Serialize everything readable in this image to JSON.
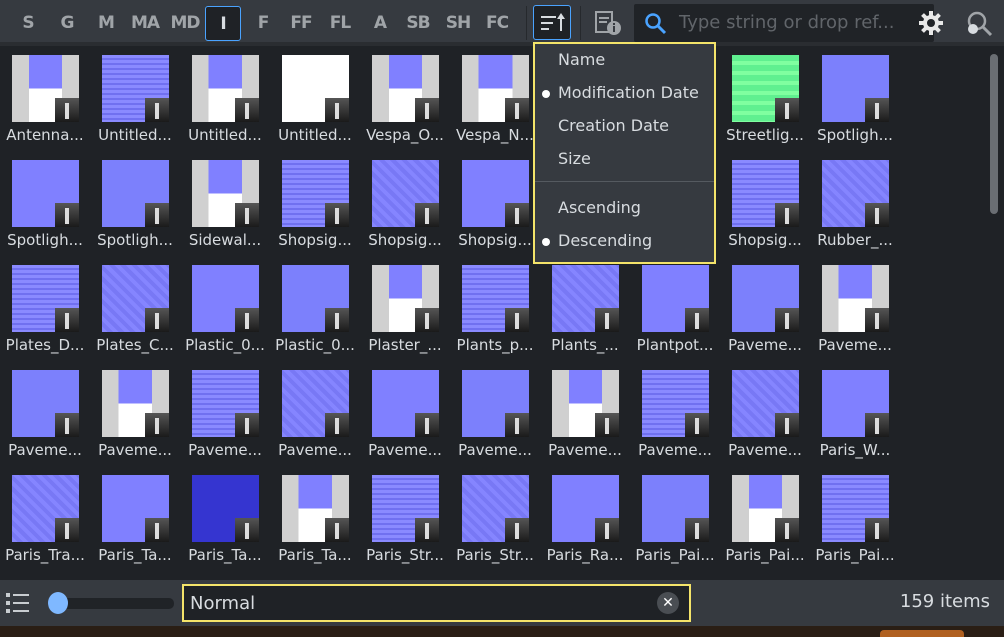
{
  "toolbar": {
    "filters": [
      {
        "label": "S"
      },
      {
        "label": "G"
      },
      {
        "label": "M"
      },
      {
        "label": "MA"
      },
      {
        "label": "MD"
      },
      {
        "label": "I",
        "active": true
      },
      {
        "label": "F"
      },
      {
        "label": "FF"
      },
      {
        "label": "FL"
      },
      {
        "label": "A"
      },
      {
        "label": "SB"
      },
      {
        "label": "SH"
      },
      {
        "label": "FC"
      }
    ],
    "sort_icon": "sort-ascending-icon",
    "info_icon": "document-info-icon",
    "search": {
      "placeholder": "Type string or drop ref...",
      "icon": "search-icon"
    },
    "settings_icon": "gear-icon",
    "find_icon": "find-references-icon"
  },
  "sort_menu": {
    "fields": [
      {
        "label": "Name",
        "selected": false
      },
      {
        "label": "Modification Date",
        "selected": true
      },
      {
        "label": "Creation Date",
        "selected": false
      },
      {
        "label": "Size",
        "selected": false
      }
    ],
    "order": [
      {
        "label": "Ascending",
        "selected": false
      },
      {
        "label": "Descending",
        "selected": true
      }
    ]
  },
  "assets": [
    [
      "Antenna...",
      "Untitled...",
      "Untitled...",
      "Untitled...",
      "Vespa_O...",
      "Vespa_N...",
      "",
      "",
      "Streetlig...",
      "Spotligh..."
    ],
    [
      "Spotligh...",
      "Spotligh...",
      "Sidewal...",
      "Shopsig...",
      "Shopsig...",
      "Shopsig...",
      "",
      "",
      "Shopsig...",
      "Rubber_..."
    ],
    [
      "Plates_D...",
      "Plates_C...",
      "Plastic_0...",
      "Plastic_0...",
      "Plaster_...",
      "Plants_p...",
      "Plants_...",
      "Plantpot...",
      "Paveme...",
      "Paveme..."
    ],
    [
      "Paveme...",
      "Paveme...",
      "Paveme...",
      "Paveme...",
      "Paveme...",
      "Paveme...",
      "Paveme...",
      "Paveme...",
      "Paveme...",
      "Paris_W..."
    ],
    [
      "Paris_Tra...",
      "Paris_Ta...",
      "Paris_Ta...",
      "Paris_Ta...",
      "Paris_Str...",
      "Paris_Str...",
      "Paris_Ra...",
      "Paris_Pai...",
      "Paris_Pai...",
      "Paris_Pai..."
    ]
  ],
  "bottom": {
    "view_icon": "list-view-icon",
    "thumb_size": 0.05,
    "filter_value": "Normal",
    "clear_icon": "close-icon",
    "count": "159 items"
  },
  "colors": {
    "accent": "#4aa3ff",
    "highlight": "#f4e46a",
    "normal_map": "#8080ff"
  }
}
